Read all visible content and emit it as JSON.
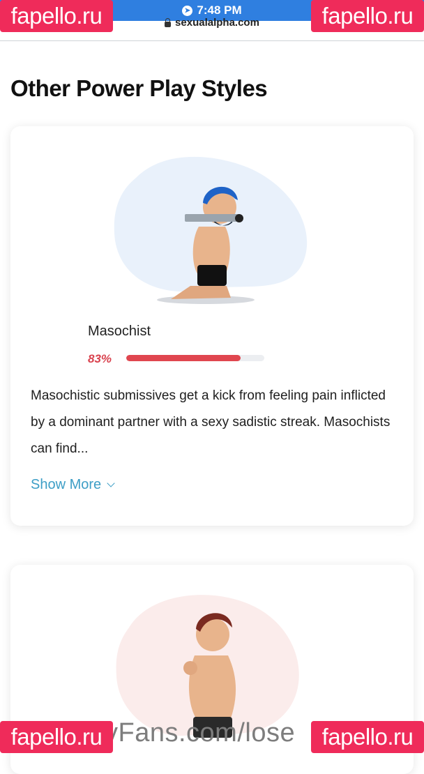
{
  "status_bar": {
    "time": "7:48 PM"
  },
  "browser": {
    "url": "sexualalpha.com"
  },
  "section": {
    "title": "Other Power Play Styles"
  },
  "cards": [
    {
      "name": "Masochist",
      "percent_label": "83%",
      "percent": 83,
      "description": "Masochistic submissives get a kick from feeling pain inflicted by a dominant partner with a sexy sadistic streak. Masochists can find...",
      "show_more": "Show More",
      "blob_color": "#e9f1fb"
    },
    {
      "blob_color": "#fbeceb"
    }
  ],
  "watermarks": {
    "top_left": "fapello.ru",
    "top_right": "fapello.ru",
    "bottom_left": "fapello.ru",
    "bottom_right": "fapello.ru"
  },
  "bottom_overlay": "yFans.com/lose"
}
